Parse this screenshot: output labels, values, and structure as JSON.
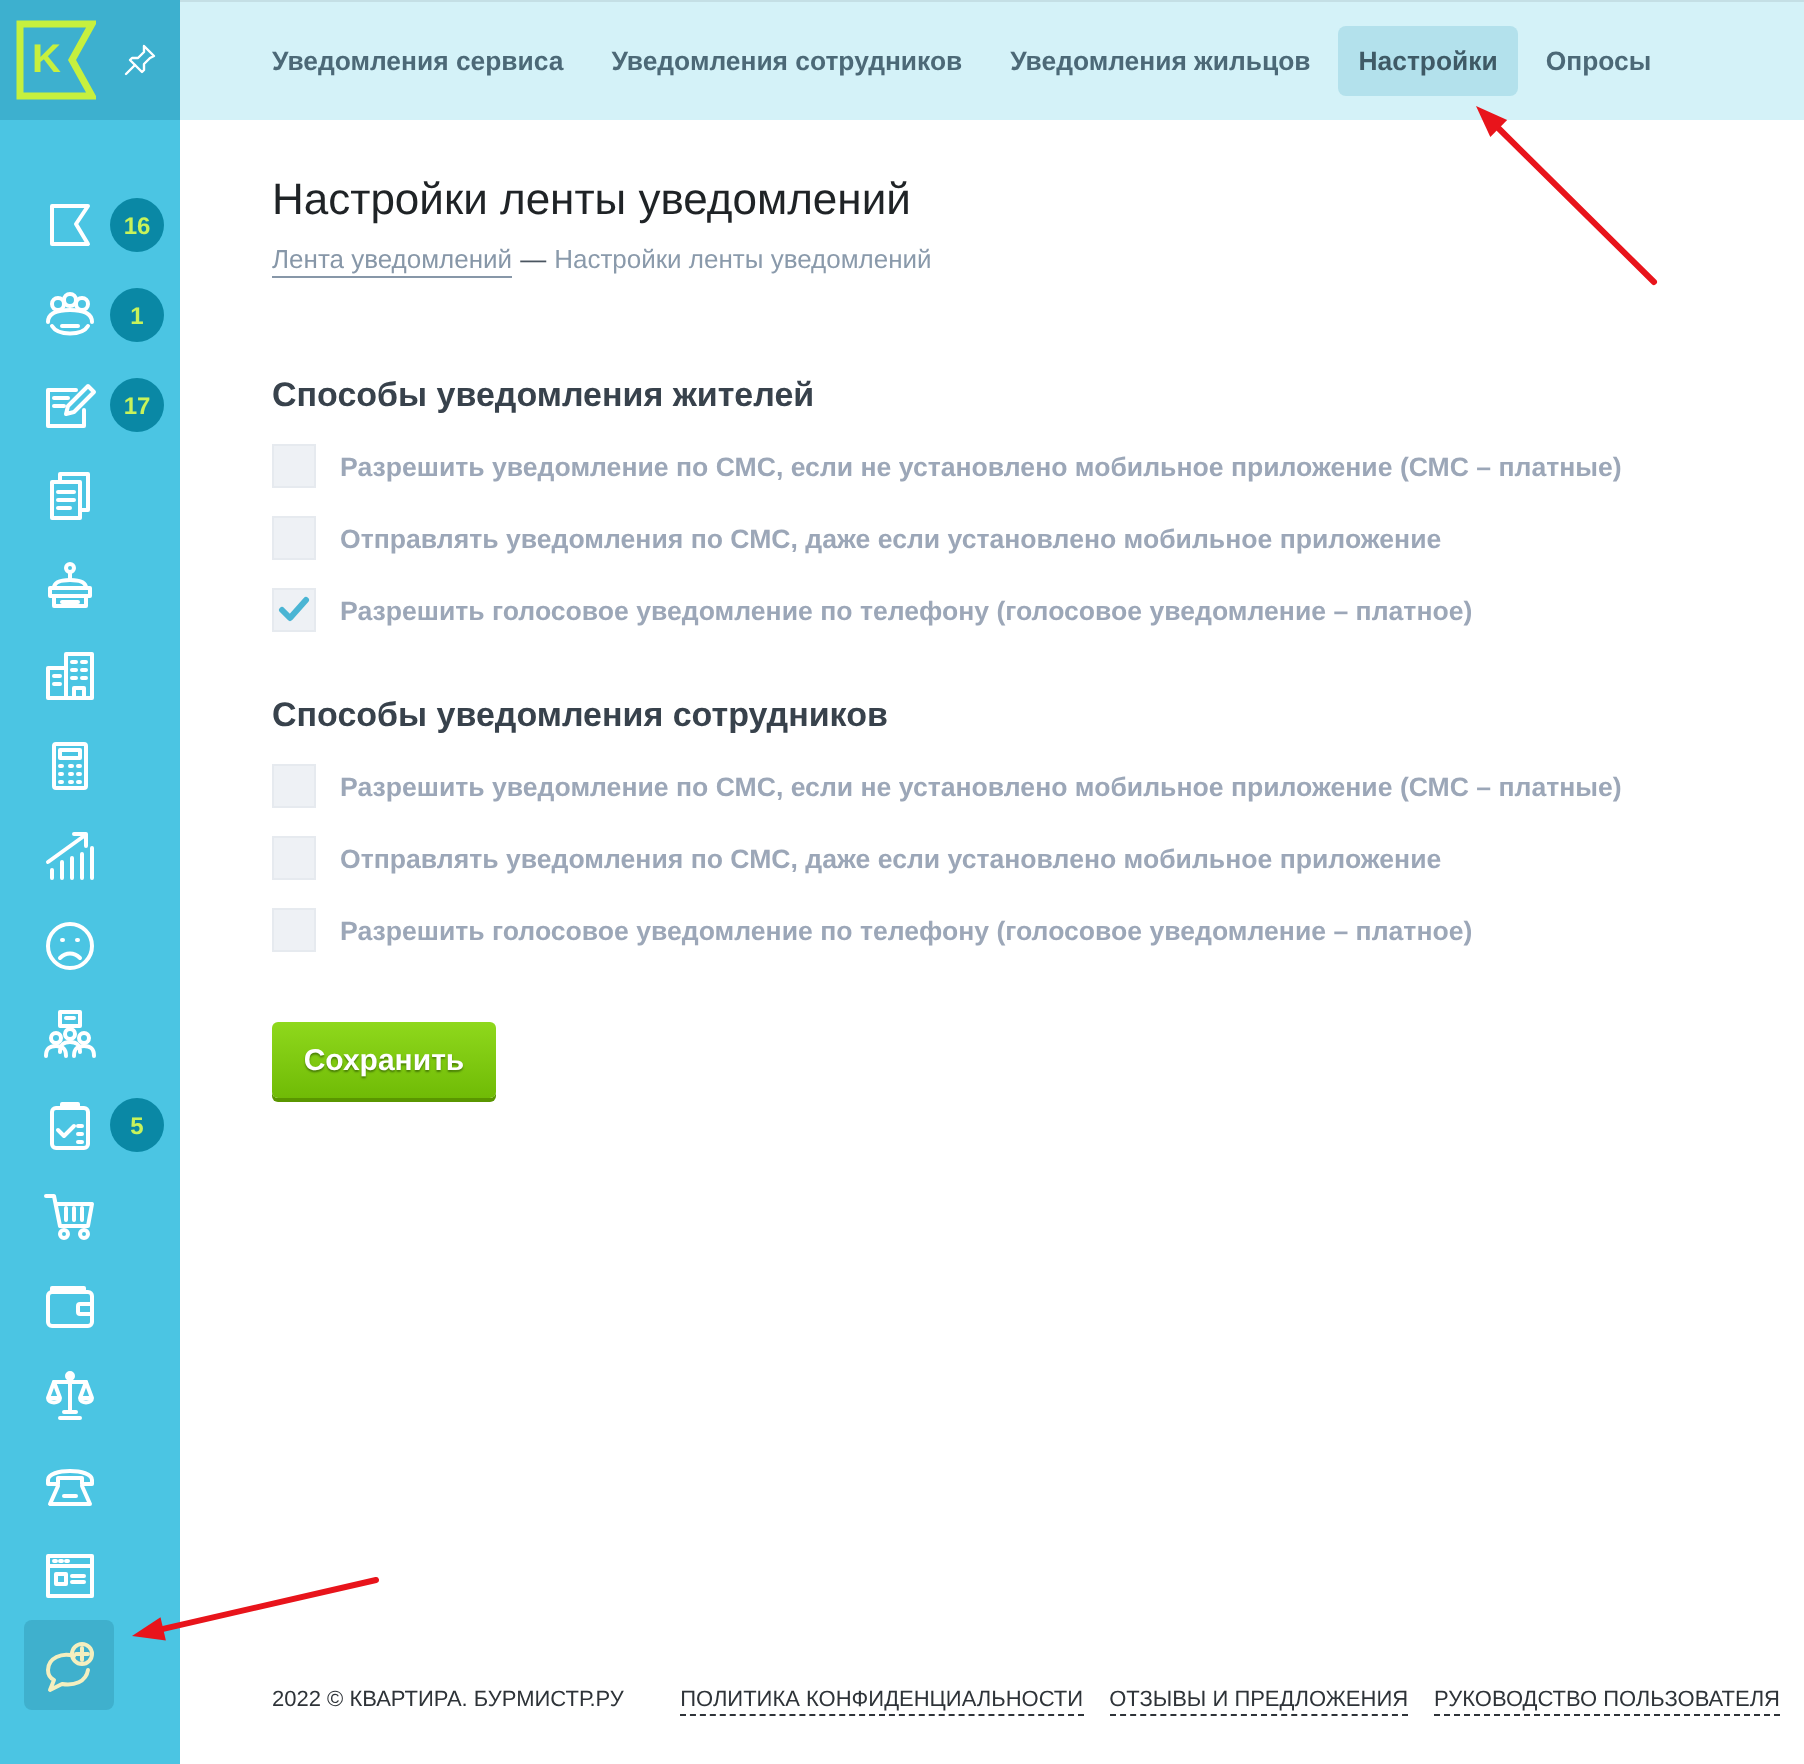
{
  "logo": {
    "letter": "K"
  },
  "sidebar": {
    "items": [
      {
        "badge": "16",
        "selected": false
      },
      {
        "badge": "1",
        "selected": false
      },
      {
        "badge": "17",
        "selected": false
      },
      {
        "selected": false
      },
      {
        "selected": false
      },
      {
        "selected": false
      },
      {
        "selected": false
      },
      {
        "selected": false
      },
      {
        "selected": false
      },
      {
        "selected": false
      },
      {
        "badge": "5",
        "selected": false
      },
      {
        "selected": false
      },
      {
        "selected": false
      },
      {
        "selected": false
      },
      {
        "selected": false
      },
      {
        "selected": false
      },
      {
        "selected": true
      }
    ]
  },
  "tabs": [
    {
      "label": "Уведомления сервиса",
      "selected": false
    },
    {
      "label": "Уведомления сотрудников",
      "selected": false
    },
    {
      "label": "Уведомления жильцов",
      "selected": false
    },
    {
      "label": "Настройки",
      "selected": true
    },
    {
      "label": "Опросы",
      "selected": false
    }
  ],
  "page": {
    "title": "Настройки ленты уведомлений",
    "breadcrumb": {
      "link": "Лента уведомлений",
      "separator": "—",
      "current": "Настройки ленты уведомлений"
    }
  },
  "sections": [
    {
      "heading": "Способы уведомления жителей",
      "options": [
        {
          "label": "Разрешить уведомление по СМС, если не установлено мобильное приложение (СМС – платные)",
          "checked": false
        },
        {
          "label": "Отправлять уведомления по СМС, даже если установлено мобильное приложение",
          "checked": false
        },
        {
          "label": "Разрешить голосовое уведомление по телефону (голосовое уведомление – платное)",
          "checked": true
        }
      ]
    },
    {
      "heading": "Способы уведомления сотрудников",
      "options": [
        {
          "label": "Разрешить уведомление по СМС, если не установлено мобильное приложение (СМС – платные)",
          "checked": false
        },
        {
          "label": "Отправлять уведомления по СМС, даже если установлено мобильное приложение",
          "checked": false
        },
        {
          "label": "Разрешить голосовое уведомление по телефону (голосовое уведомление – платное)",
          "checked": false
        }
      ]
    }
  ],
  "save_button": "Сохранить",
  "footer": {
    "copyright": "2022 © КВАРТИРА. БУРМИСТР.РУ",
    "links": [
      "ПОЛИТИКА КОНФИДЕНЦИАЛЬНОСТИ",
      "ОТЗЫВЫ И ПРЕДЛОЖЕНИЯ",
      "РУКОВОДСТВО ПОЛЬЗОВАТЕЛЯ"
    ]
  }
}
